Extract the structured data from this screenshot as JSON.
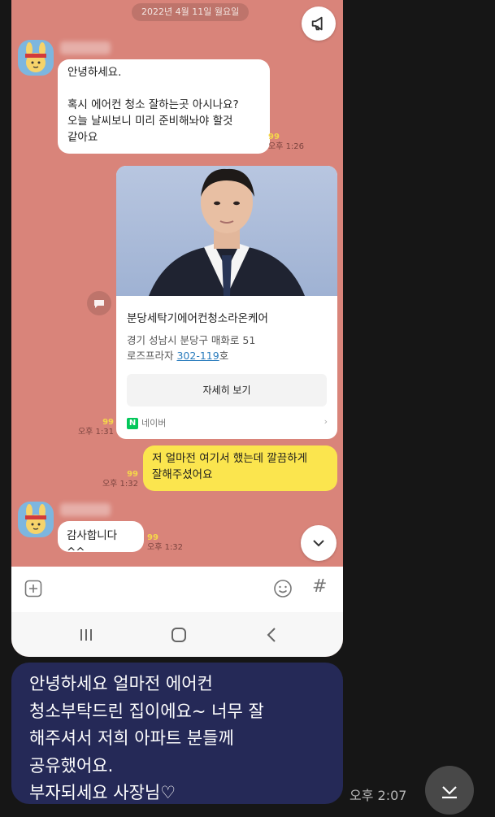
{
  "chat": {
    "date": "2022년 4월 11일 월요일",
    "messages": [
      {
        "text": "안녕하세요.\n\n혹시 에어컨 청소 잘하는곳 아시나요?\n오늘 날씨보니 미리 준비해놔야 할것\n같아요",
        "unread": "99",
        "time": "오후 1:26"
      },
      {
        "text": "저 얼마전 여기서 했는데 깔끔하게\n잘해주셨어요",
        "unread": "99",
        "time": "오후 1:32"
      },
      {
        "text": "감사합니다^^",
        "unread": "99",
        "time": "오후 1:32"
      }
    ],
    "card": {
      "title": "분당세탁기에어컨청소라온케어",
      "addr_line1": "경기 성남시 분당구 매화로 51",
      "addr_line2_prefix": "로즈프라자 ",
      "addr_phone": "302-119",
      "addr_line2_suffix": "호",
      "button": "자세히 보기",
      "source_logo": "N",
      "source": "네이버",
      "unread": "99",
      "time": "오후 1:31"
    }
  },
  "input_bar": {
    "plus_icon": "plus-square-icon",
    "emoji_icon": "smile-icon",
    "hash_icon": "#"
  },
  "review": {
    "text": "안녕하세요 얼마전 에어컨\n청소부탁드린 집이에요~ 너무 잘\n해주셔서 저희 아파트 분들께\n공유했어요.\n부자되세요 사장님♡",
    "time": "오후 2:07"
  },
  "colors": {
    "chat_bg": "#d9847a",
    "yellow_bubble": "#fbe54e",
    "review_bubble": "#252957",
    "naver_green": "#03c75a"
  }
}
